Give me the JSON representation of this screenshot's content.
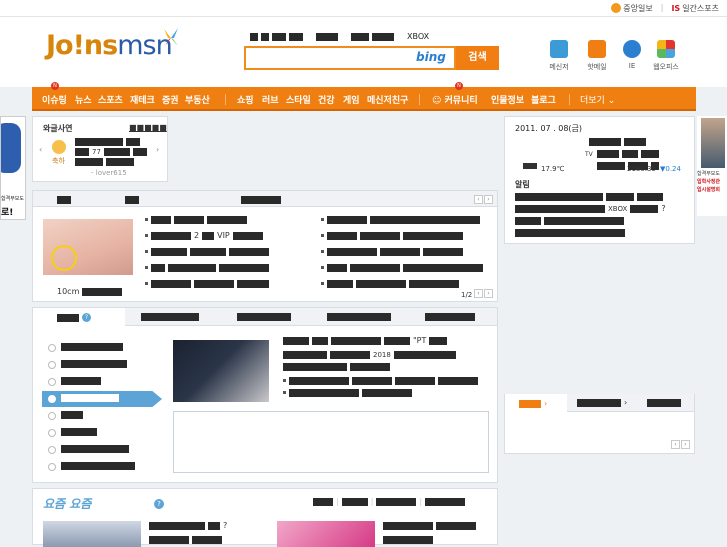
{
  "topbar": {
    "partner1": "중앙일보",
    "partner2": "일간스포츠",
    "partner2_prefix": "IS"
  },
  "logo": {
    "joins": "Jo!ns",
    "msn": "msn"
  },
  "search": {
    "xbox": "XBOX",
    "bing": "bing",
    "button": "검색",
    "placeholder": ""
  },
  "top_icons": [
    {
      "label": "메신저",
      "color": "#3c9ad6"
    },
    {
      "label": "핫메일",
      "color": "#f07e12"
    },
    {
      "label": "IE",
      "color": "#2a7fd0"
    },
    {
      "label": "웹오피스",
      "color": "#4a9e4a"
    }
  ],
  "nav": {
    "items": [
      "이슈링",
      "뉴스",
      "스포츠",
      "재테크",
      "증권",
      "부동산",
      "쇼핑",
      "러브",
      "스타일",
      "건강",
      "게임",
      "메신저친구",
      "커뮤니티",
      "인물정보",
      "블로그",
      "더보기"
    ]
  },
  "waagle": {
    "title": "와글사연",
    "more": "■■■■■",
    "caption": "축하",
    "num": "77",
    "user": "- lover615"
  },
  "left_side": {
    "caption1": "합격부모도",
    "caption2": "로!"
  },
  "right_side": {
    "line1": "합격부모도",
    "line2": "입학사정관",
    "line3": "입시설명회"
  },
  "datebox": {
    "date": "2011. 07 . 08(금)",
    "temp": "17.9℃",
    "index": "2180.35",
    "change": "▼0.24",
    "tv": "TV"
  },
  "notice": {
    "title": "알림",
    "xbox": "XBOX",
    "q": "?"
  },
  "news": {
    "photo_caption": "10cm",
    "page": "1/2",
    "vip": "VIP",
    "num2": "2"
  },
  "mid": {
    "num": "2018",
    "pt": "\"PT",
    "news1_q": "?"
  },
  "ezine": {
    "logo": "요즘 요즘",
    "q": "?"
  },
  "colors": {
    "orange": "#f07e12",
    "blue": "#2a7fd0",
    "lightblue": "#5da4d6"
  }
}
